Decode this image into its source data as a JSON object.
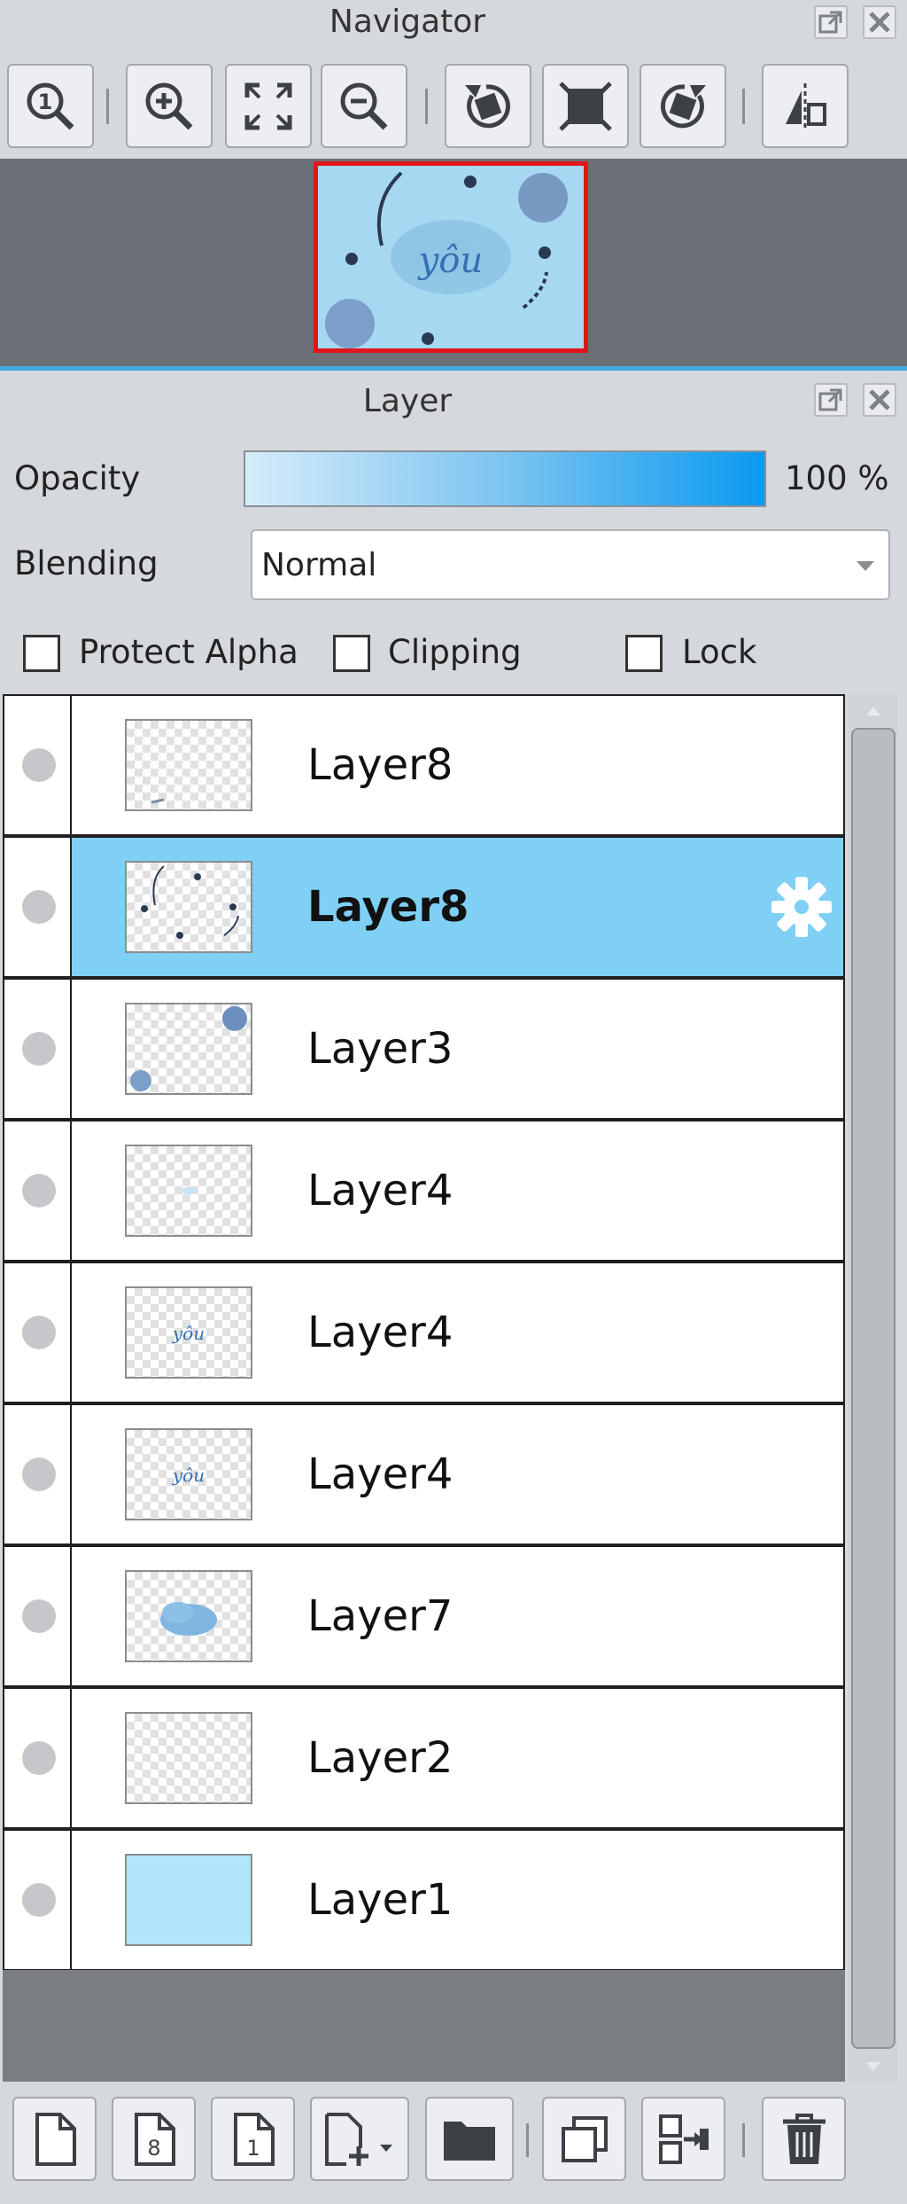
{
  "navigator": {
    "title": "Navigator",
    "tools": [
      {
        "name": "zoom-actual-icon"
      },
      {
        "name": "zoom-in-icon"
      },
      {
        "name": "fit-screen-icon"
      },
      {
        "name": "zoom-out-icon"
      },
      {
        "name": "rotate-left-icon"
      },
      {
        "name": "reset-rotation-icon"
      },
      {
        "name": "rotate-right-icon"
      },
      {
        "name": "flip-horizontal-icon"
      }
    ],
    "preview": {
      "text": "yôu",
      "frame_color": "#e2141c",
      "bg_color": "#a6d9f1"
    }
  },
  "layer_panel": {
    "title": "Layer",
    "opacity_label": "Opacity",
    "opacity_value": "100 %",
    "opacity_fraction": 1.0,
    "blending_label": "Blending",
    "blending_value": "Normal",
    "checkboxes": {
      "protect_alpha": "Protect Alpha",
      "clipping": "Clipping",
      "lock": "Lock"
    },
    "layers": [
      {
        "name": "Layer8",
        "thumb": "empty",
        "selected": false
      },
      {
        "name": "Layer8",
        "thumb": "dots",
        "selected": true
      },
      {
        "name": "Layer3",
        "thumb": "circles",
        "selected": false
      },
      {
        "name": "Layer4",
        "thumb": "empty",
        "selected": false
      },
      {
        "name": "Layer4",
        "thumb": "text",
        "thumb_text": "yôu",
        "selected": false
      },
      {
        "name": "Layer4",
        "thumb": "text",
        "thumb_text": "yôu",
        "selected": false
      },
      {
        "name": "Layer7",
        "thumb": "blob",
        "selected": false
      },
      {
        "name": "Layer2",
        "thumb": "empty",
        "selected": false
      },
      {
        "name": "Layer1",
        "thumb": "solid",
        "selected": false
      }
    ],
    "selected_color": "#7fd0f4",
    "bottom_tools": [
      {
        "name": "new-layer-icon"
      },
      {
        "name": "new-8bit-layer-icon",
        "label": "8"
      },
      {
        "name": "new-1bit-layer-icon",
        "label": "1"
      },
      {
        "name": "new-layer-dropdown-icon"
      },
      {
        "name": "new-folder-icon"
      },
      {
        "name": "duplicate-layer-icon"
      },
      {
        "name": "merge-down-icon"
      },
      {
        "name": "delete-layer-icon"
      }
    ]
  }
}
